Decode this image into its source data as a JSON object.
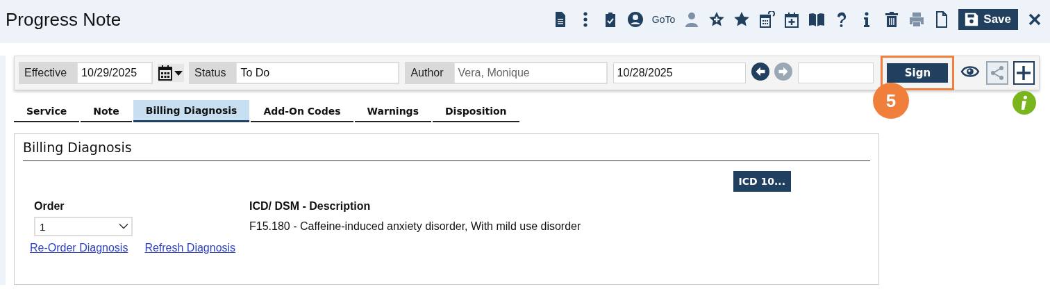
{
  "window": {
    "title": "Progress Note"
  },
  "toolbar": {
    "items": [
      {
        "kind": "document",
        "disabled": false
      },
      {
        "kind": "more",
        "disabled": false
      },
      {
        "kind": "clipboard-check",
        "disabled": false
      },
      {
        "kind": "avatar",
        "disabled": false
      },
      {
        "kind": "goto",
        "label": "GoTo",
        "disabled": false
      },
      {
        "kind": "person",
        "disabled": true
      },
      {
        "kind": "star-plus",
        "disabled": false
      },
      {
        "kind": "star",
        "disabled": false
      },
      {
        "kind": "calendar-refresh",
        "disabled": false
      },
      {
        "kind": "calendar-plus",
        "disabled": false
      },
      {
        "kind": "book",
        "disabled": false
      },
      {
        "kind": "help",
        "disabled": false
      },
      {
        "kind": "info",
        "disabled": false
      },
      {
        "kind": "trash",
        "disabled": false
      },
      {
        "kind": "print",
        "disabled": true
      },
      {
        "kind": "blank-page",
        "disabled": false
      },
      {
        "kind": "save",
        "label": "Save",
        "disabled": false
      },
      {
        "kind": "close",
        "disabled": false
      }
    ]
  },
  "fields": {
    "effective": {
      "label": "Effective",
      "value": "10/29/2025"
    },
    "status": {
      "label": "Status",
      "value": "To Do"
    },
    "author": {
      "label": "Author",
      "value": "Vera, Monique",
      "disabled": true
    },
    "date": {
      "value": "10/28/2025"
    },
    "previous": {
      "disabled": false
    },
    "next": {
      "disabled": true
    },
    "sign": {
      "label": "Sign",
      "highlighted": true,
      "step": "5"
    },
    "share": {
      "disabled": true
    }
  },
  "tabs": [
    {
      "label": "Service",
      "selected": false
    },
    {
      "label": "Note",
      "selected": false
    },
    {
      "label": "Billing Diagnosis",
      "selected": true
    },
    {
      "label": "Add-On Codes",
      "selected": false
    },
    {
      "label": "Warnings",
      "selected": false
    },
    {
      "label": "Disposition",
      "selected": false
    }
  ],
  "section": {
    "title": "Billing Diagnosis",
    "icd_button": "ICD 10...",
    "order_heading": "Order",
    "description_heading": "ICD/ DSM - Description",
    "rows": [
      {
        "order": "1",
        "description": "F15.180 - Caffeine-induced anxiety disorder, With mild use disorder"
      }
    ],
    "links": [
      "Re-Order Diagnosis ",
      "Refresh Diagnosis"
    ]
  }
}
